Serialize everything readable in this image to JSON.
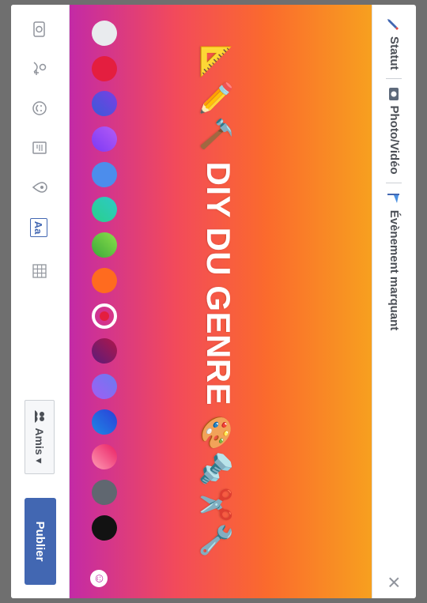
{
  "composer": {
    "tabs": [
      {
        "label": "Statut"
      },
      {
        "label": "Photo/Vidéo"
      },
      {
        "label": "Évènement marquant"
      }
    ],
    "close_glyph": "×"
  },
  "canvas": {
    "text": "DIY DU GENRE",
    "emoji_left": "📐✏️🔨",
    "emoji_right": "🎨🔩✂️🔧",
    "gradient": [
      "#f7a01f",
      "#fb6a2d",
      "#f24a5b",
      "#c32aa6"
    ],
    "swatches": [
      {
        "name": "white",
        "color": "#e9ebee"
      },
      {
        "name": "red",
        "color": "#e41e3f"
      },
      {
        "name": "purple-blue",
        "color": "linear-gradient(135deg,#7b3fe4,#3a5ad8)"
      },
      {
        "name": "purple",
        "color": "linear-gradient(135deg,#b45cf5,#7b39f5)"
      },
      {
        "name": "blue",
        "color": "#4c8dec"
      },
      {
        "name": "teal",
        "color": "linear-gradient(135deg,#2ec8c8,#29d18a)"
      },
      {
        "name": "green",
        "color": "linear-gradient(135deg,#8ce04a,#3aa83a)"
      },
      {
        "name": "orange",
        "color": "#ff6b1f"
      },
      {
        "name": "selected-red",
        "color": "#ffffff",
        "selected": true
      },
      {
        "name": "maroon",
        "color": "linear-gradient(135deg,#b0174a,#5a1c7a)"
      },
      {
        "name": "blue-purple",
        "color": "linear-gradient(135deg,#6a7bf0,#a15ef3)"
      },
      {
        "name": "navy",
        "color": "linear-gradient(135deg,#2b3fd8,#1e88e5)"
      },
      {
        "name": "pink",
        "color": "linear-gradient(135deg,#e91e63,#ff9bb5)"
      },
      {
        "name": "gray",
        "color": "#606770"
      },
      {
        "name": "black",
        "color": "#121212"
      }
    ]
  },
  "toolbar": {
    "icons": [
      "camera-icon",
      "tag-people-icon",
      "feeling-icon",
      "checkin-icon",
      "location-icon",
      "text-style-icon",
      "grid-icon"
    ],
    "aa_label": "Aa",
    "audience_label": "Amis ▾",
    "publish_label": "Publier"
  }
}
